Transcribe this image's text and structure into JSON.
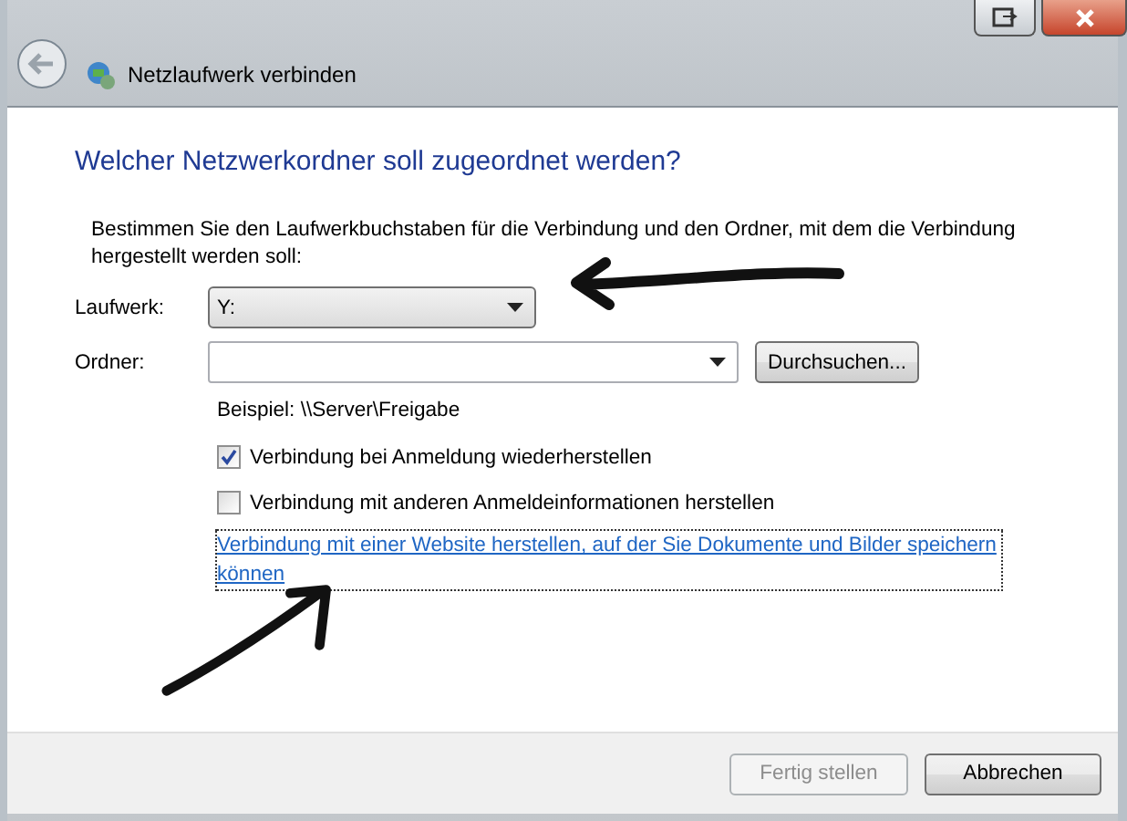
{
  "window": {
    "title": "Netzlaufwerk verbinden"
  },
  "heading": "Welcher Netzwerkordner soll zugeordnet werden?",
  "instructions": "Bestimmen Sie den Laufwerkbuchstaben für die Verbindung und den Ordner, mit dem die Verbindung hergestellt werden soll:",
  "drive": {
    "label": "Laufwerk:",
    "value": "Y:",
    "arrow_annotation": true
  },
  "folder": {
    "label": "Ordner:",
    "browse_button": "Durchsuchen..."
  },
  "example": "Beispiel: \\\\Server\\Freigabe",
  "checkboxes": [
    {
      "label": "Verbindung bei Anmeldung wiederherstellen",
      "checked": true
    },
    {
      "label": "Verbindung mit anderen Anmeldeinformationen herstellen",
      "checked": false
    }
  ],
  "link": {
    "text": "Verbindung mit einer Website herstellen, auf der Sie Dokumente und Bilder speichern können",
    "arrow_annotation": true
  },
  "buttons": [
    {
      "label": "Fertig stellen",
      "disabled": true
    },
    {
      "label": "Abbrechen",
      "disabled": false
    }
  ]
}
